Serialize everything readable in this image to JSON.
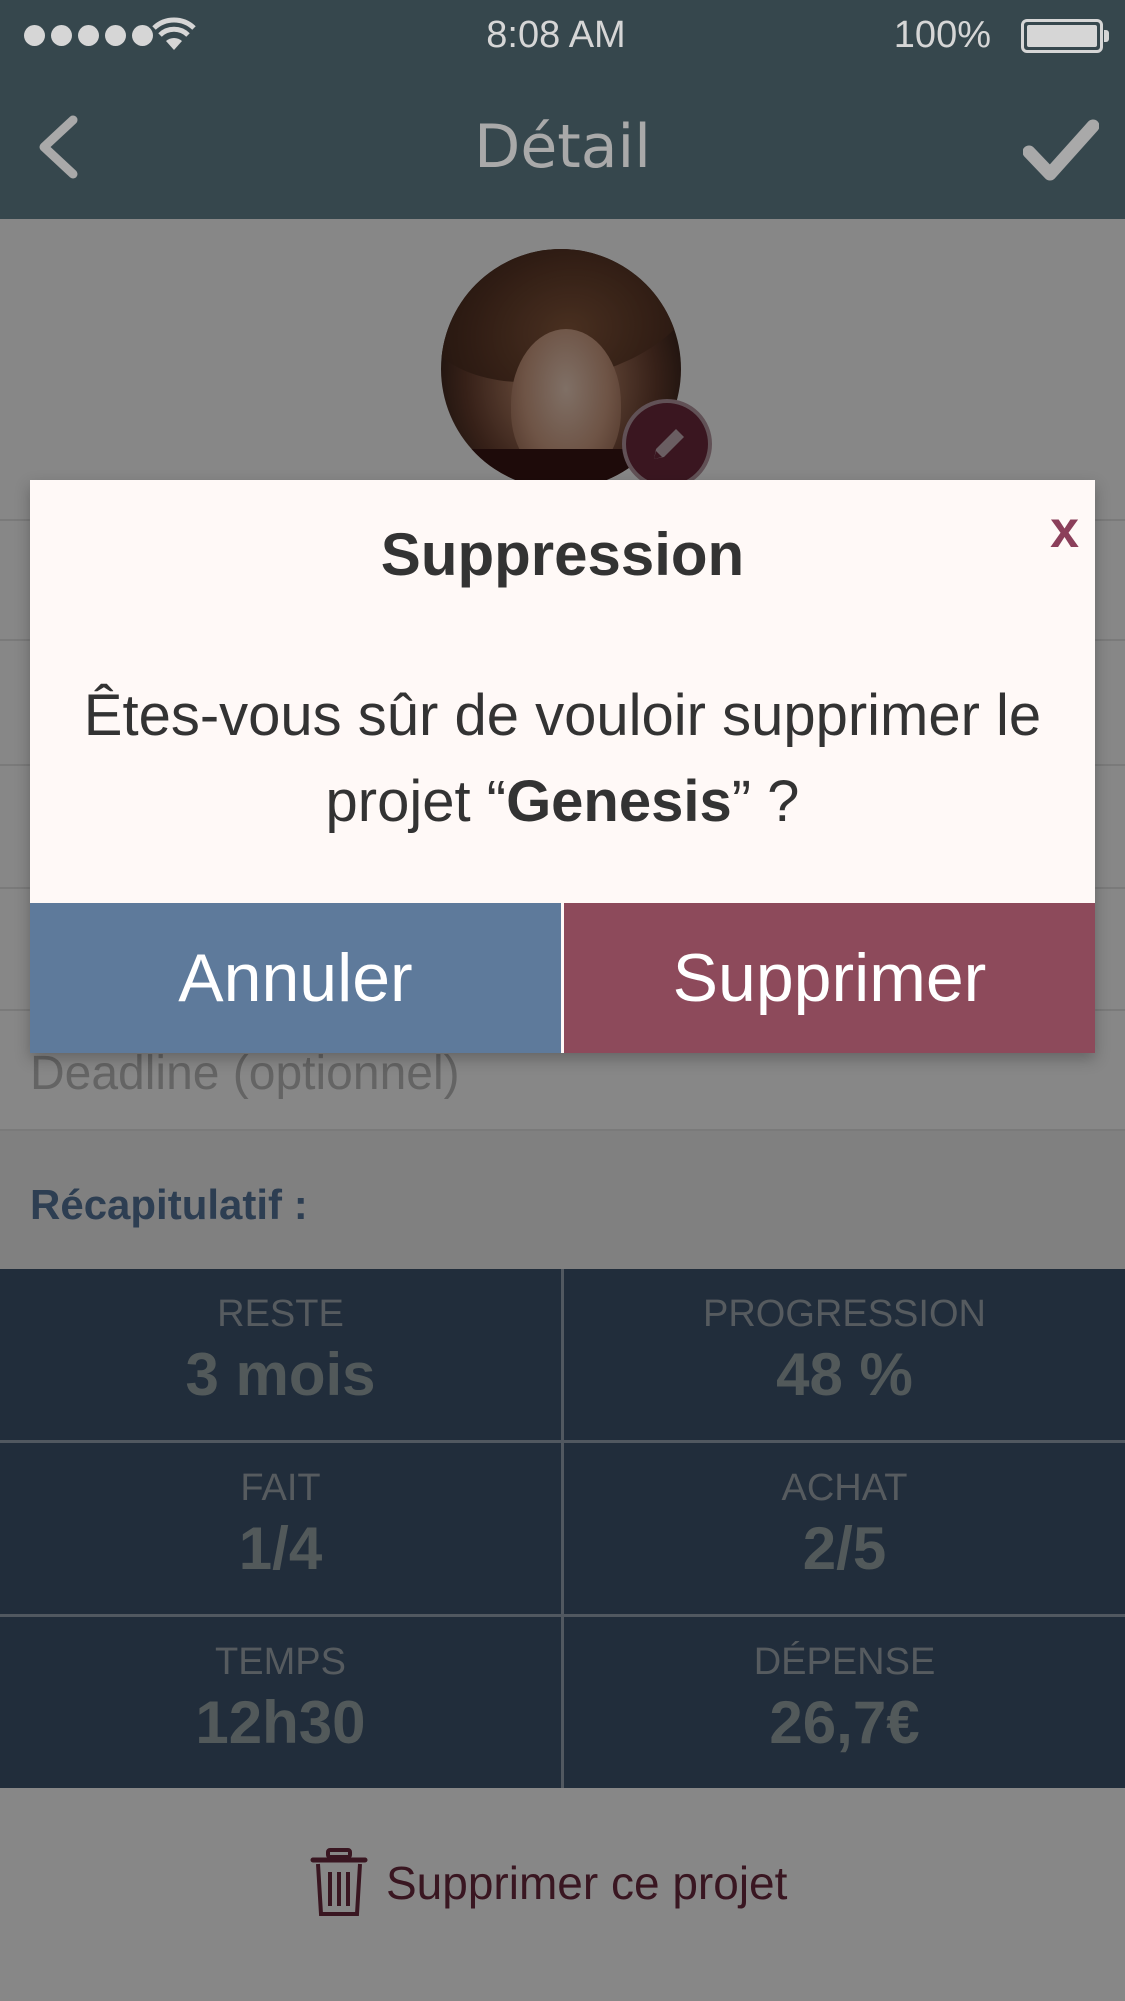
{
  "status_bar": {
    "time": "8:08 AM",
    "battery_percent": "100%",
    "battery_level": 1.0,
    "icons": [
      "signal-dots-icon",
      "wifi-icon",
      "battery-icon"
    ]
  },
  "nav": {
    "title": "Détail",
    "back_icon": "chevron-left-icon",
    "confirm_icon": "checkmark-icon"
  },
  "form": {
    "avatar_icon": "avatar",
    "edit_icon": "pencil-icon",
    "deadline_placeholder": "Deadline (optionnel)"
  },
  "recap": {
    "title": "Récapitulatif :",
    "stats": [
      {
        "label": "RESTE",
        "value": "3 mois"
      },
      {
        "label": "PROGRESSION",
        "value": "48 %"
      },
      {
        "label": "FAIT",
        "value": "1/4"
      },
      {
        "label": "ACHAT",
        "value": "2/5"
      },
      {
        "label": "TEMPS",
        "value": "12h30"
      },
      {
        "label": "DÉPENSE",
        "value": "26,7€"
      }
    ]
  },
  "delete_project": {
    "label": "Supprimer ce projet",
    "icon": "trash-icon"
  },
  "dialog": {
    "title": "Suppression",
    "close_label": "x",
    "message_prefix": "Êtes-vous sûr de vouloir supprimer le projet “",
    "project_name": "Genesis",
    "message_suffix": "” ?",
    "cancel_label": "Annuler",
    "confirm_label": "Supprimer"
  },
  "colors": {
    "nav_bg": "#36474d",
    "stats_bg": "#3f5570",
    "cancel_button": "#5e7a9b",
    "delete_button": "#8d4a5b",
    "accent_red": "#8b3f5a"
  }
}
